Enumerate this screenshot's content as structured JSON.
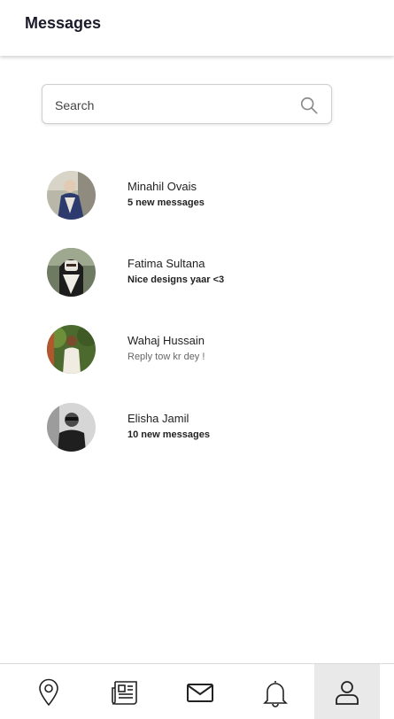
{
  "header": {
    "title": "Messages"
  },
  "search": {
    "placeholder": "Search",
    "icon": "search-icon"
  },
  "conversations": [
    {
      "name": "Minahil Ovais",
      "preview": "5 new messages",
      "unread": true
    },
    {
      "name": "Fatima Sultana",
      "preview": "Nice designs yaar <3",
      "unread": true
    },
    {
      "name": "Wahaj Hussain",
      "preview": "Reply tow kr dey !",
      "unread": false
    },
    {
      "name": "Elisha Jamil",
      "preview": "10 new messages",
      "unread": true
    }
  ],
  "tabbar": {
    "items": [
      {
        "icon": "map-pin-icon"
      },
      {
        "icon": "newspaper-icon"
      },
      {
        "icon": "mail-icon"
      },
      {
        "icon": "bell-icon"
      },
      {
        "icon": "profile-icon",
        "active": true
      }
    ]
  }
}
